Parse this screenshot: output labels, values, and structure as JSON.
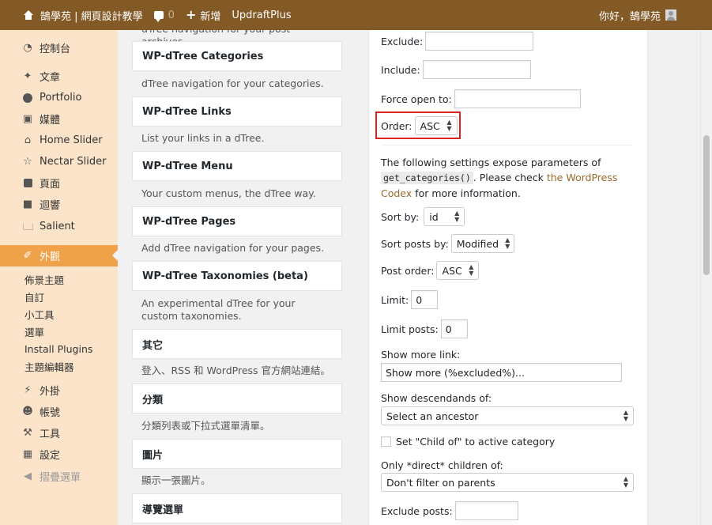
{
  "adminbar": {
    "site_name": "鵠學苑 | 網頁設計教學",
    "comments_count": "0",
    "new_label": "新增",
    "plugin_label": "UpdraftPlus",
    "greeting": "你好，鵠學苑"
  },
  "sidebar": {
    "items": [
      {
        "label": "控制台",
        "icon": "dashboard-icon"
      },
      {
        "label": "文章",
        "icon": "pin-icon"
      },
      {
        "label": "Portfolio",
        "icon": "portfolio-icon"
      },
      {
        "label": "媒體",
        "icon": "media-icon"
      },
      {
        "label": "Home Slider",
        "icon": "home-icon"
      },
      {
        "label": "Nectar Slider",
        "icon": "star-icon"
      },
      {
        "label": "頁面",
        "icon": "page-icon"
      },
      {
        "label": "迴響",
        "icon": "comment-icon"
      },
      {
        "label": "Salient",
        "icon": "crown-icon"
      },
      {
        "label": "外觀",
        "icon": "brush-icon"
      },
      {
        "label": "外掛",
        "icon": "plugin-icon"
      },
      {
        "label": "帳號",
        "icon": "user-icon"
      },
      {
        "label": "工具",
        "icon": "wrench-icon"
      },
      {
        "label": "設定",
        "icon": "settings-icon"
      },
      {
        "label": "摺疊選單",
        "icon": "collapse-icon"
      }
    ],
    "submenu": [
      "佈景主題",
      "自訂",
      "小工具",
      "選單",
      "Install Plugins",
      "主題編輯器"
    ]
  },
  "widgets": {
    "top_cut_text": "dTree navigation for your post archives.",
    "list": [
      {
        "title": "WP-dTree Categories",
        "desc": "dTree navigation for your categories."
      },
      {
        "title": "WP-dTree Links",
        "desc": "List your links in a dTree."
      },
      {
        "title": "WP-dTree Menu",
        "desc": "Your custom menus, the dTree way."
      },
      {
        "title": "WP-dTree Pages",
        "desc": "Add dTree navigation for your pages."
      },
      {
        "title": "WP-dTree Taxonomies (beta)",
        "desc": "An experimental dTree for your custom taxonomies."
      },
      {
        "title": "其它",
        "desc": "登入、RSS 和 WordPress 官方網站連結。"
      },
      {
        "title": "分類",
        "desc": "分類列表或下拉式選單清單。"
      },
      {
        "title": "圖片",
        "desc": "顯示一張圖片。"
      },
      {
        "title": "導覽選單",
        "desc": ""
      }
    ]
  },
  "panel": {
    "exclude_label": "Exclude:",
    "exclude_value": "",
    "include_label": "Include:",
    "include_value": "",
    "force_open_label": "Force open to:",
    "force_open_value": "",
    "order_label": "Order:",
    "order_value": "ASC",
    "para_text_1": "The following settings expose parameters of",
    "para_code": "get_categories()",
    "para_text_2": ". Please check",
    "para_link": "the WordPress Codex",
    "para_text_3": "for more information.",
    "sort_by_label": "Sort by:",
    "sort_by_value": "id",
    "sort_posts_label": "Sort posts by:",
    "sort_posts_value": "Modified",
    "post_order_label": "Post order:",
    "post_order_value": "ASC",
    "limit_label": "Limit:",
    "limit_value": "0",
    "limit_posts_label": "Limit posts:",
    "limit_posts_value": "0",
    "show_more_label": "Show more link:",
    "show_more_value": "Show more (%excluded%)...",
    "descendants_label": "Show descendands of:",
    "descendants_value": "Select an ancestor",
    "child_of_label": "Set \"Child of\" to active category",
    "direct_children_label": "Only *direct* children of:",
    "direct_children_value": "Don't filter on parents",
    "exclude_posts_label": "Exclude posts:",
    "exclude_posts_value": ""
  },
  "colors": {
    "adminbar": "#835926",
    "sidebar": "#fbe4c9",
    "current_menu": "#f0a24a",
    "highlight_border": "#dd2222"
  }
}
